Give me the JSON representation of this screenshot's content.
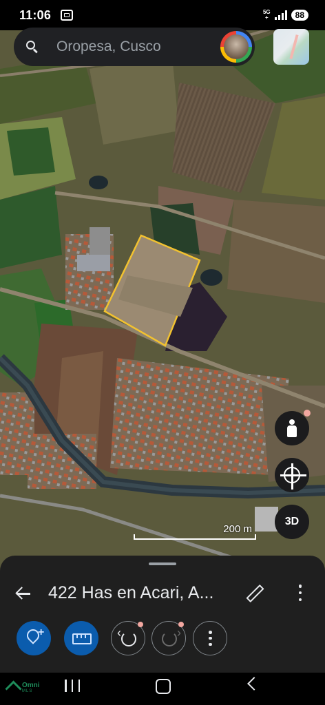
{
  "status_bar": {
    "time": "11:06",
    "network": "5G",
    "network_sub": "+",
    "battery": "88"
  },
  "search": {
    "placeholder": "Oropesa, Cusco"
  },
  "map": {
    "scale_label": "200 m",
    "btn_3d_label": "3D",
    "parcel_outline_color": "#f2c230"
  },
  "sheet": {
    "title": "422 Has en Acari, A..."
  },
  "toolbar": {
    "icons": [
      "add-pin-icon",
      "ruler-icon",
      "undo-icon",
      "redo-icon",
      "more-icon"
    ],
    "accent_color": "#0b5cad"
  },
  "watermark": {
    "line1": "Omni",
    "line2": "MLS"
  }
}
